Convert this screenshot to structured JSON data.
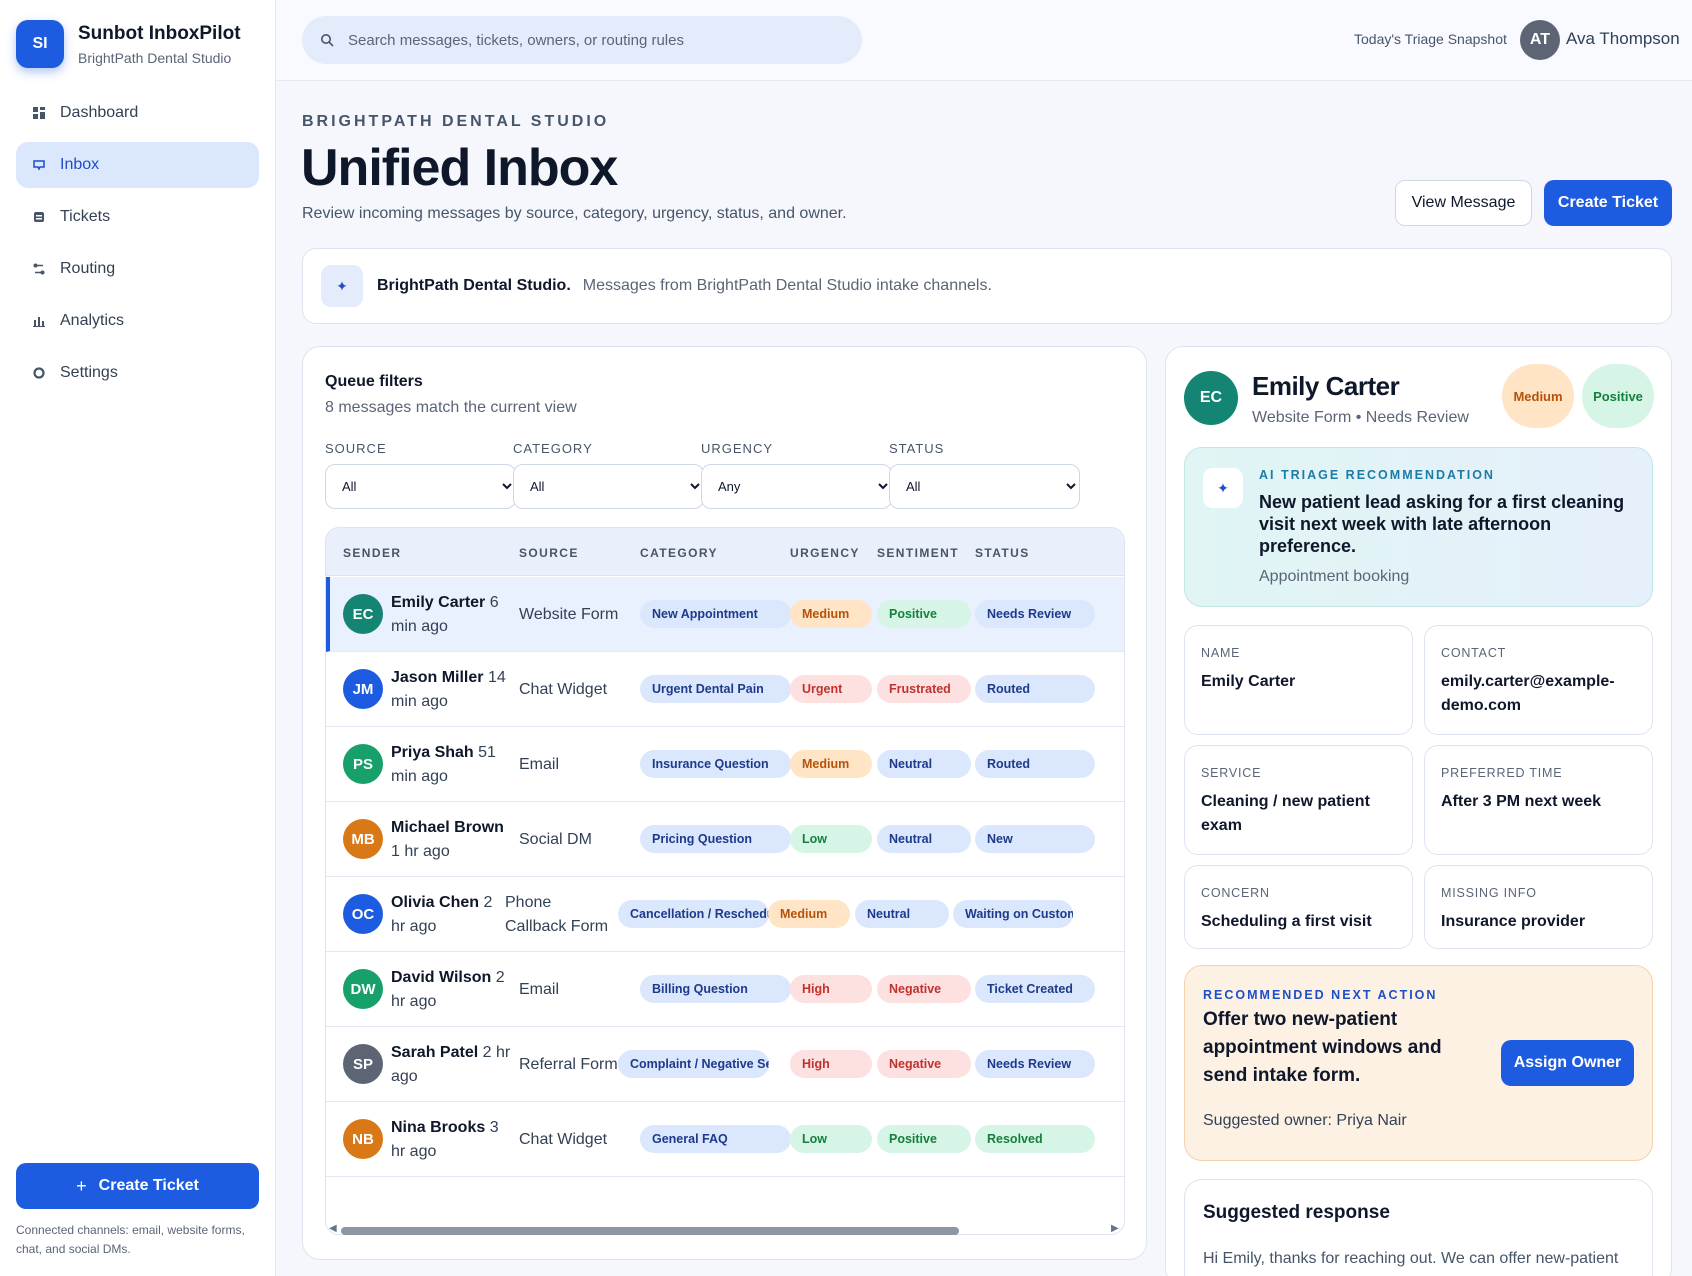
{
  "app": {
    "name": "Sunbot InboxPilot",
    "subtitle": "BrightPath Dental Studio",
    "logo_initials": "SI"
  },
  "sidebar": {
    "items": [
      {
        "label": "Dashboard",
        "icon": "dashboard-icon",
        "active": false
      },
      {
        "label": "Inbox",
        "icon": "inbox-icon",
        "active": true
      },
      {
        "label": "Tickets",
        "icon": "tickets-icon",
        "active": false
      },
      {
        "label": "Routing",
        "icon": "routing-icon",
        "active": false
      },
      {
        "label": "Analytics",
        "icon": "analytics-icon",
        "active": false
      },
      {
        "label": "Settings",
        "icon": "settings-icon",
        "active": false
      }
    ],
    "create_label": "Create Ticket",
    "channels_note": "Connected channels: email, website forms, chat, and social DMs."
  },
  "topbar": {
    "search_placeholder": "Search messages, tickets, owners, or routing rules",
    "snapshot_label": "Today's Triage Snapshot",
    "user_initials": "AT",
    "user_name": "Ava Thompson"
  },
  "header": {
    "eyebrow": "BRIGHTPATH DENTAL STUDIO",
    "title": "Unified Inbox",
    "subtitle": "Review incoming messages by source, category, urgency, status, and owner.",
    "view_label": "View Message",
    "create_label": "Create Ticket"
  },
  "banner": {
    "strong": "BrightPath Dental Studio.",
    "text": "Messages from BrightPath Dental Studio intake channels."
  },
  "queue": {
    "title": "Queue filters",
    "count_text": "8 messages match the current view",
    "filters": [
      {
        "label": "SOURCE",
        "value": "All"
      },
      {
        "label": "CATEGORY",
        "value": "All"
      },
      {
        "label": "URGENCY",
        "value": "Any"
      },
      {
        "label": "STATUS",
        "value": "All"
      }
    ],
    "columns": [
      "SENDER",
      "SOURCE",
      "CATEGORY",
      "URGENCY",
      "SENTIMENT",
      "STATUS"
    ],
    "rows": [
      {
        "initials": "EC",
        "color": "#138572",
        "name": "Emily Carter",
        "time": "6 min ago",
        "source": "Website Form",
        "category": "New Appointment",
        "urgency": "Medium",
        "sentiment": "Positive",
        "status": "Needs Review"
      },
      {
        "initials": "JM",
        "color": "#1d5ce0",
        "name": "Jason Miller",
        "time": "14 min ago",
        "source": "Chat Widget",
        "category": "Urgent Dental Pain",
        "urgency": "Urgent",
        "sentiment": "Frustrated",
        "status": "Routed"
      },
      {
        "initials": "PS",
        "color": "#18a06a",
        "name": "Priya Shah",
        "time": "51 min ago",
        "source": "Email",
        "category": "Insurance Question",
        "urgency": "Medium",
        "sentiment": "Neutral",
        "status": "Routed"
      },
      {
        "initials": "MB",
        "color": "#d97817",
        "name": "Michael Brown",
        "time": "1 hr ago",
        "source": "Social DM",
        "category": "Pricing Question",
        "urgency": "Low",
        "sentiment": "Neutral",
        "status": "New"
      },
      {
        "initials": "OC",
        "color": "#1d5ce0",
        "name": "Olivia Chen",
        "time": "2 hr ago",
        "source": "Phone Callback Form",
        "category": "Cancellation / Reschedule",
        "urgency": "Medium",
        "sentiment": "Neutral",
        "status": "Waiting on Customer"
      },
      {
        "initials": "DW",
        "color": "#18a06a",
        "name": "David Wilson",
        "time": "2 hr ago",
        "source": "Email",
        "category": "Billing Question",
        "urgency": "High",
        "sentiment": "Negative",
        "status": "Ticket Created"
      },
      {
        "initials": "SP",
        "color": "#5d6474",
        "name": "Sarah Patel",
        "time": "2 hr ago",
        "source": "Referral Form",
        "category": "Complaint / Negative Sentiment",
        "urgency": "High",
        "sentiment": "Negative",
        "status": "Needs Review"
      },
      {
        "initials": "NB",
        "color": "#d97817",
        "name": "Nina Brooks",
        "time": "3 hr ago",
        "source": "Chat Widget",
        "category": "General FAQ",
        "urgency": "Low",
        "sentiment": "Positive",
        "status": "Resolved"
      }
    ]
  },
  "detail": {
    "initials": "EC",
    "name": "Emily Carter",
    "meta": "Website Form • Needs Review",
    "urgency_badge": "Medium",
    "sentiment_badge": "Positive",
    "ai_eyebrow": "AI TRIAGE RECOMMENDATION",
    "ai_title": "New patient lead asking for a first cleaning visit next week with late afternoon preference.",
    "ai_category": "Appointment booking",
    "fields": [
      {
        "label": "NAME",
        "value": "Emily Carter"
      },
      {
        "label": "CONTACT",
        "value": "emily.carter@example-demo.com"
      },
      {
        "label": "SERVICE",
        "value": "Cleaning / new patient exam"
      },
      {
        "label": "PREFERRED TIME",
        "value": "After 3 PM next week"
      },
      {
        "label": "CONCERN",
        "value": "Scheduling a first visit"
      },
      {
        "label": "MISSING INFO",
        "value": "Insurance provider"
      }
    ],
    "action_eyebrow": "RECOMMENDED NEXT ACTION",
    "action_title": "Offer two new-patient appointment windows and send intake form.",
    "assign_label": "Assign Owner",
    "owner_text": "Suggested owner: Priya Nair",
    "response_title": "Suggested response",
    "response_text": "Hi Emily, thanks for reaching out. We can offer new-patient"
  },
  "colors": {
    "accent": "#1d5ce0",
    "active_nav_bg": "#dbe7fd"
  }
}
